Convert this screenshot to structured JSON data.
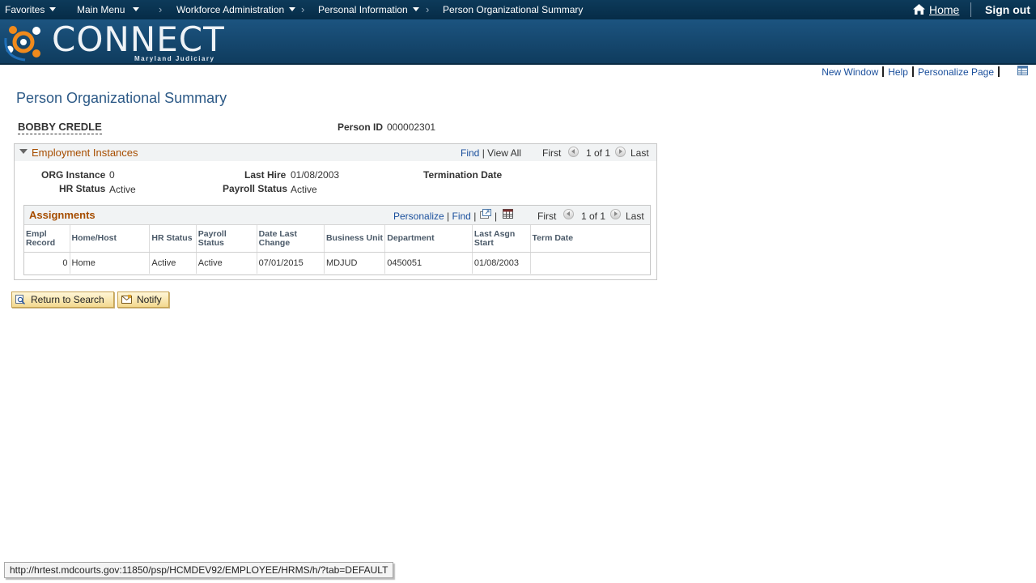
{
  "topnav": {
    "favorites": "Favorites",
    "main_menu": "Main Menu",
    "workforce_admin": "Workforce Administration",
    "personal_info": "Personal Information",
    "current": "Person Organizational Summary",
    "home": "Home",
    "sign_out": "Sign out"
  },
  "banner": {
    "logo_text": "CONNECT",
    "logo_sub": "Maryland Judiciary"
  },
  "pagelinks": {
    "new_window": "New Window",
    "help": "Help",
    "personalize_page": "Personalize Page"
  },
  "page": {
    "title": "Person Organizational Summary",
    "person_name": "BOBBY CREDLE",
    "person_id_label": "Person ID",
    "person_id": "000002301"
  },
  "employment": {
    "title": "Employment Instances",
    "find": "Find",
    "view_all": "View All",
    "first": "First",
    "count": "1 of 1",
    "last": "Last",
    "org_instance_label": "ORG Instance",
    "org_instance": "0",
    "last_hire_label": "Last Hire",
    "last_hire": "01/08/2003",
    "termination_label": "Termination Date",
    "hr_status_label": "HR Status",
    "hr_status": "Active",
    "payroll_status_label": "Payroll Status",
    "payroll_status": "Active"
  },
  "assignments": {
    "title": "Assignments",
    "personalize": "Personalize",
    "find": "Find",
    "first": "First",
    "count": "1 of 1",
    "last": "Last",
    "columns": [
      [
        "Empl",
        "Record"
      ],
      [
        "Home/Host",
        ""
      ],
      [
        "HR Status",
        ""
      ],
      [
        "Payroll Status",
        ""
      ],
      [
        "Date Last",
        "Change"
      ],
      [
        "Business Unit",
        ""
      ],
      [
        "Department",
        ""
      ],
      [
        "Last Asgn",
        "Start"
      ],
      [
        "Term Date",
        ""
      ]
    ],
    "row": {
      "empl_record": "0",
      "home_host": "Home",
      "hr_status": "Active",
      "payroll_status": "Active",
      "date_last_change": "07/01/2015",
      "business_unit": "MDJUD",
      "department": "0450051",
      "last_asgn_start": "01/08/2003",
      "term_date": ""
    }
  },
  "buttons": {
    "return_to_search": "Return to Search",
    "notify": "Notify"
  },
  "statusbar": "http://hrtest.mdcourts.gov:11850/psp/HCMDEV92/EMPLOYEE/HRMS/h/?tab=DEFAULT",
  "colors": {
    "nav_bg": "#0d3a5a",
    "banner_bg": "#1c5480",
    "link": "#1a4f9c",
    "section_title": "#a64d00",
    "page_title": "#2d5a87"
  }
}
